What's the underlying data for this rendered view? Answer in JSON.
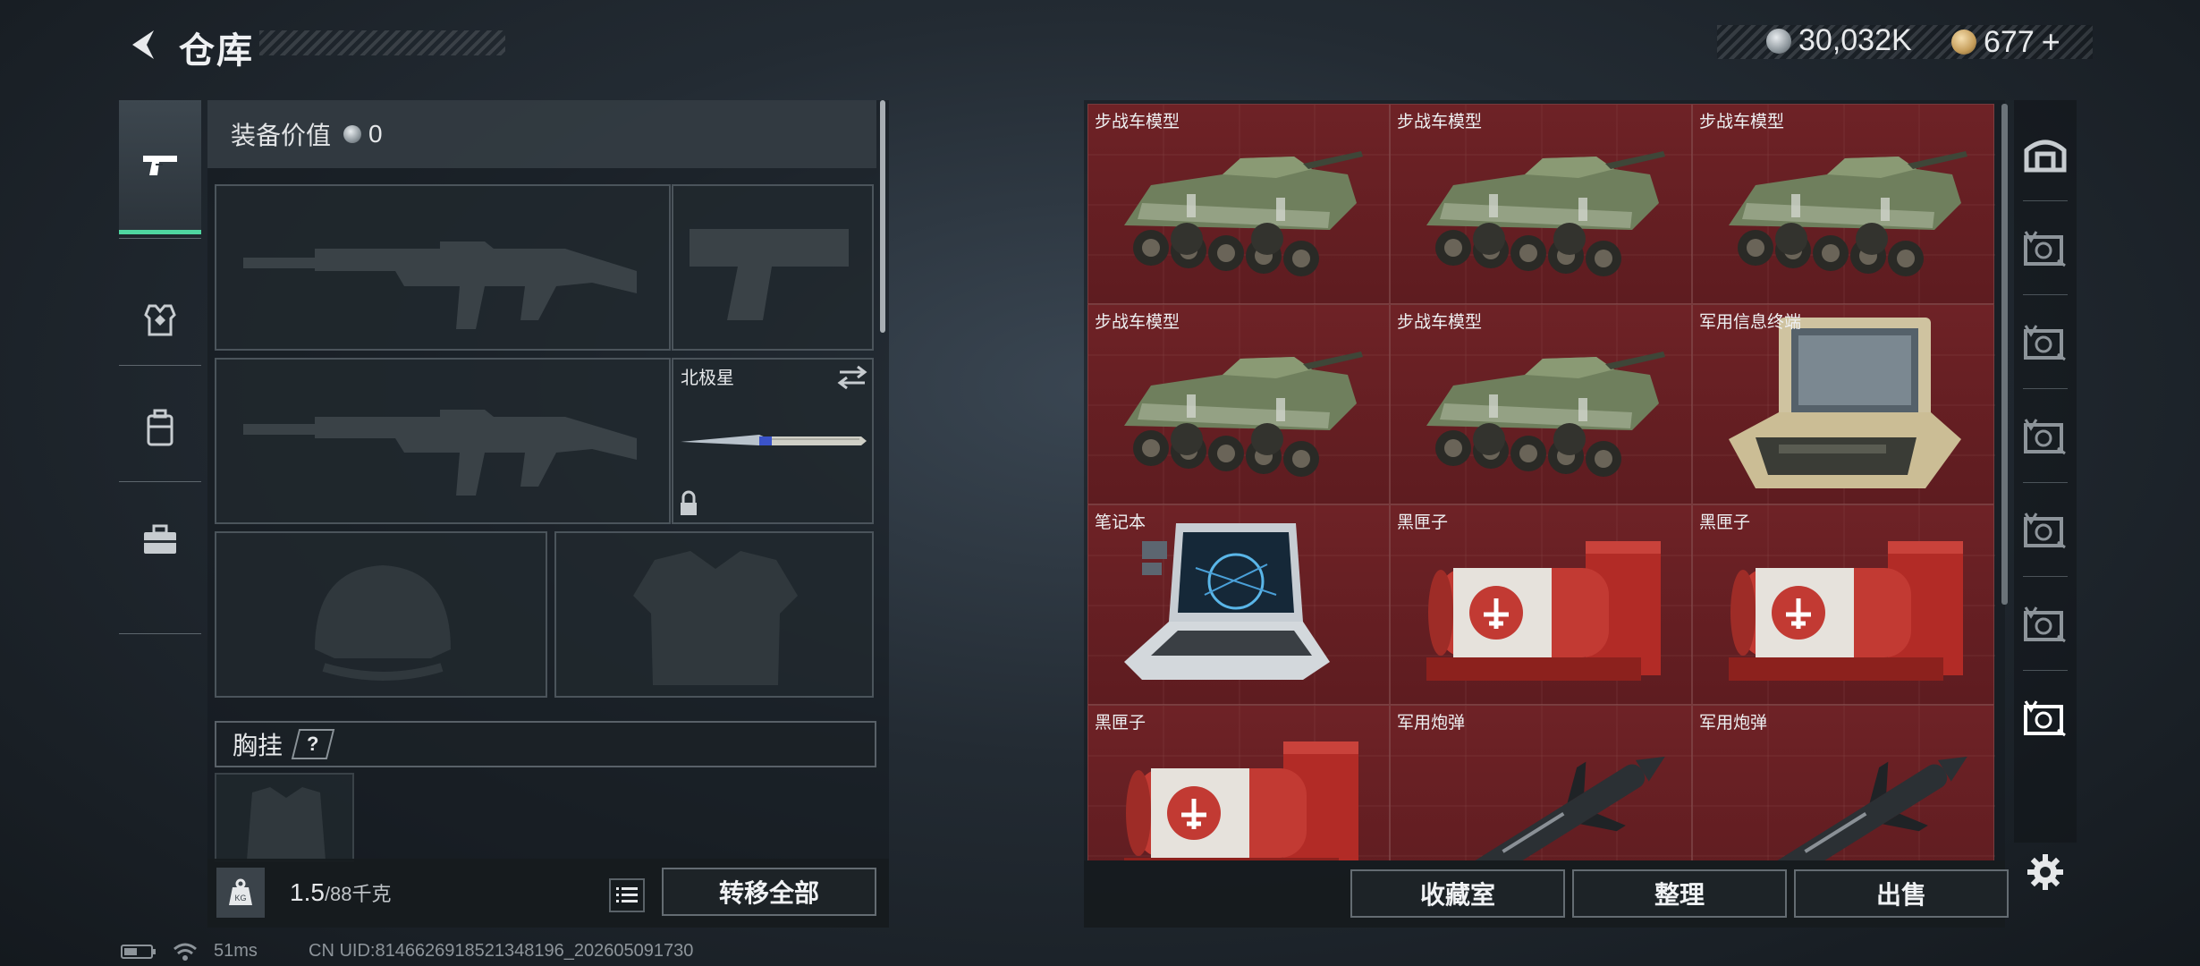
{
  "header": {
    "title": "仓库",
    "back_icon": "back-arrow-icon"
  },
  "currency": {
    "silver": "30,032K",
    "gold": "677",
    "plus": "+"
  },
  "left_tabs": [
    {
      "name": "weapon",
      "icon": "pistol-icon",
      "active": true
    },
    {
      "name": "armor",
      "icon": "vest-icon"
    },
    {
      "name": "backpack",
      "icon": "backpack-icon"
    },
    {
      "name": "briefcase",
      "icon": "briefcase-icon"
    }
  ],
  "equipment": {
    "value_label": "装备价值",
    "value": "0",
    "melee_label": "北极星",
    "chest_label": "胸挂",
    "chest_help": "?",
    "weight_current": "1.5",
    "weight_max": "/88千克",
    "transfer_all": "转移全部"
  },
  "stash": {
    "items": [
      {
        "label": "步战车模型",
        "icon": "ifv-model-icon"
      },
      {
        "label": "步战车模型",
        "icon": "ifv-model-icon"
      },
      {
        "label": "步战车模型",
        "icon": "ifv-model-icon"
      },
      {
        "label": "步战车模型",
        "icon": "ifv-model-icon"
      },
      {
        "label": "步战车模型",
        "icon": "ifv-model-icon"
      },
      {
        "label": "军用信息终端",
        "icon": "military-terminal-icon"
      },
      {
        "label": "笔记本",
        "icon": "laptop-icon"
      },
      {
        "label": "黑匣子",
        "icon": "black-box-icon"
      },
      {
        "label": "黑匣子",
        "icon": "black-box-icon"
      },
      {
        "label": "黑匣子",
        "icon": "black-box-icon"
      },
      {
        "label": "军用炮弹",
        "icon": "artillery-shell-icon"
      },
      {
        "label": "军用炮弹",
        "icon": "artillery-shell-icon"
      }
    ],
    "cell_color": "#6e2226",
    "buttons": {
      "collection": "收藏室",
      "organize": "整理",
      "sell": "出售"
    }
  },
  "right_tabs": [
    "stash-home-icon",
    "stash-iv-icon",
    "stash-v-icon",
    "stash-v-icon",
    "stash-iv-icon",
    "stash-v-icon",
    "stash-v-icon-active"
  ],
  "status": {
    "ping": "51ms",
    "uid": "CN UID:8146626918521348196_202605091730"
  },
  "colors": {
    "accent": "#4fd6a0"
  }
}
